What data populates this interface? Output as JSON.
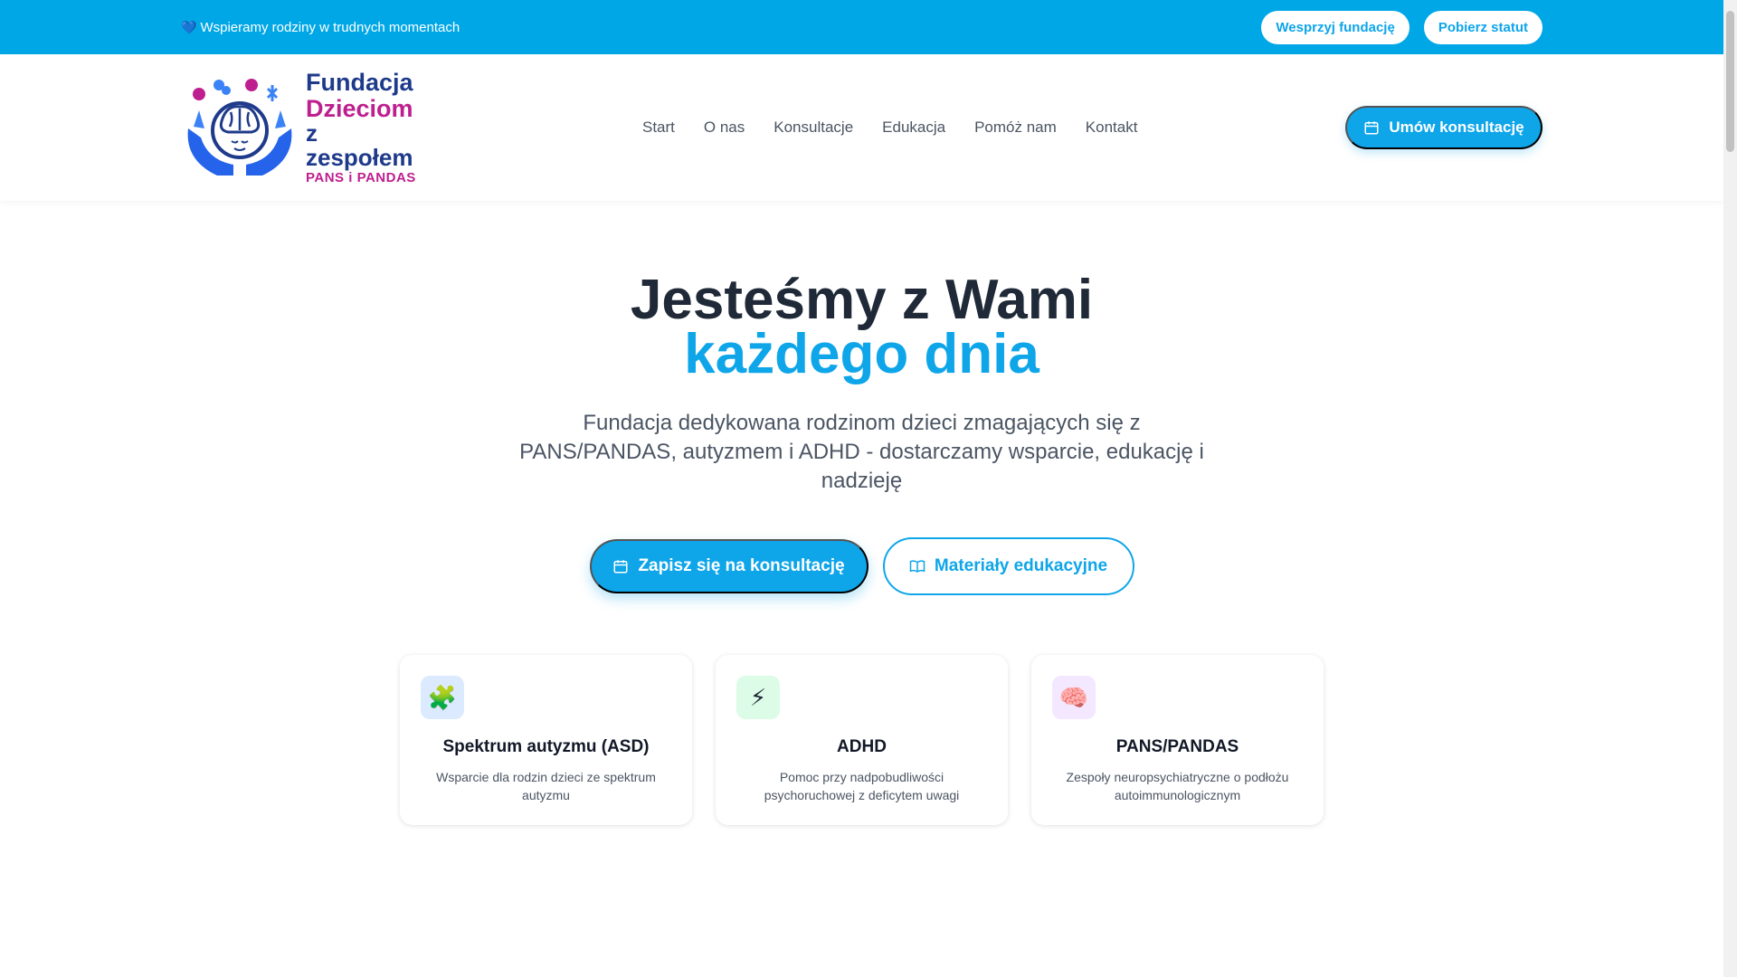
{
  "topbar": {
    "message": "Wspieramy rodziny w trudnych momentach",
    "heart_icon": "blue-heart-icon",
    "support_button": "Wesprzyj fundację",
    "statute_button": "Pobierz statut"
  },
  "logo": {
    "line1": "Fundacja",
    "line2": "Dzieciom",
    "line3": "z zespołem",
    "line4": "PANS i PANDAS"
  },
  "nav": {
    "items": [
      {
        "label": "Start"
      },
      {
        "label": "O nas"
      },
      {
        "label": "Konsultacje"
      },
      {
        "label": "Edukacja"
      },
      {
        "label": "Pomóż nam"
      },
      {
        "label": "Kontakt"
      }
    ],
    "cta": "Umów konsultację"
  },
  "hero": {
    "title_line1": "Jesteśmy z Wami",
    "title_line2": "każdego dnia",
    "subtitle": "Fundacja dedykowana rodzinom dzieci zmagających się z PANS/PANDAS, autyzmem i ADHD - dostarczamy wsparcie, edukację i nadzieję",
    "primary_button": "Zapisz się na konsultację",
    "secondary_button": "Materiały edukacyjne"
  },
  "cards": [
    {
      "icon": "puzzle-icon",
      "glyph": "🧩",
      "title": "Spektrum autyzmu (ASD)",
      "description": "Wsparcie dla rodzin dzieci ze spektrum autyzmu",
      "bg": "#dbeafe"
    },
    {
      "icon": "lightning-icon",
      "glyph": "⚡",
      "title": "ADHD",
      "description": "Pomoc przy nadpobudliwości psychoruchowej z deficytem uwagi",
      "bg": "#dcfce7"
    },
    {
      "icon": "brain-icon",
      "glyph": "🧠",
      "title": "PANS/PANDAS",
      "description": "Zespoły neuropsychiatryczne o podłożu autoimmunologicznym",
      "bg": "#f3e8ff"
    }
  ],
  "colors": {
    "primary": "#0ea5e9",
    "topbar": "#00a7e7",
    "logo_blue": "#1e3a8a",
    "logo_magenta": "#be1f8f"
  }
}
